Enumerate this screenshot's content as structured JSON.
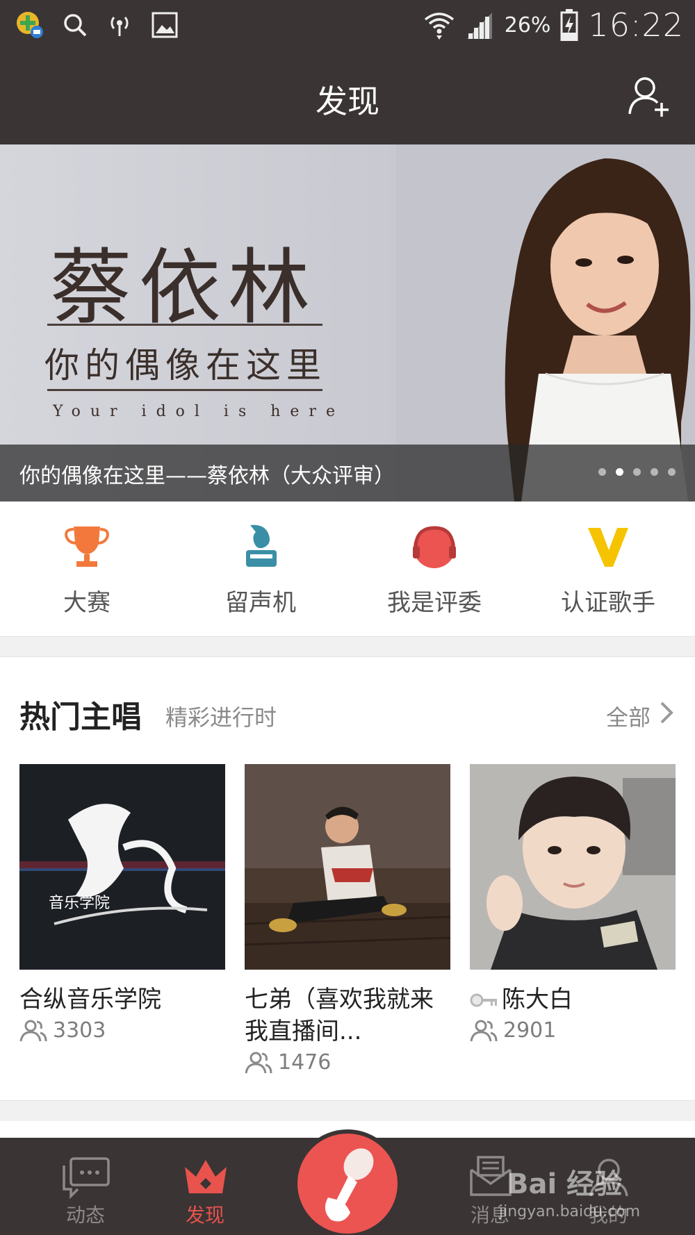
{
  "status_bar": {
    "battery_percent": "26%",
    "time": "16:22",
    "icons_left": [
      "app-notification-icon",
      "search-icon",
      "hotspot-icon",
      "image-icon"
    ],
    "icons_right": [
      "wifi-icon",
      "signal-icon",
      "battery-charging-icon"
    ]
  },
  "header": {
    "title": "发现",
    "action_icon": "add-friend-icon"
  },
  "banner": {
    "title": "蔡依林",
    "subtitle": "你的偶像在这里",
    "english": "Your idol is here",
    "caption": "你的偶像在这里——蔡依林（大众评审）",
    "page_count": 5,
    "active_index": 1
  },
  "quick_entries": [
    {
      "label": "大赛",
      "icon": "trophy-icon",
      "color": "#f2793b"
    },
    {
      "label": "留声机",
      "icon": "phonograph-icon",
      "color": "#3a8fa6"
    },
    {
      "label": "我是评委",
      "icon": "headphones-icon",
      "color": "#ec5451"
    },
    {
      "label": "认证歌手",
      "icon": "verified-v-icon",
      "color": "#f5c300"
    }
  ],
  "hot_singers": {
    "title": "热门主唱",
    "subtitle": "精彩进行时",
    "all_label": "全部",
    "cards": [
      {
        "name": "合纵音乐学院",
        "count": "3303",
        "thumb_text": "音乐学院",
        "has_key": false
      },
      {
        "name": "七弟（喜欢我就来我直播间...",
        "count": "1476",
        "has_key": false
      },
      {
        "name": "陈大白",
        "count": "2901",
        "has_key": true
      }
    ]
  },
  "tabbar": {
    "tabs": [
      {
        "label": "动态",
        "icon": "chat-bubble-icon",
        "active": false
      },
      {
        "label": "发现",
        "icon": "crown-icon",
        "active": true
      },
      {
        "label": "消息",
        "icon": "envelope-icon",
        "active": false
      },
      {
        "label": "我的",
        "icon": "profile-icon",
        "active": false
      }
    ],
    "center_icon": "microphone-icon"
  },
  "watermark": {
    "text": "Bai 经验",
    "url": "jingyan.baidu.com"
  },
  "colors": {
    "bar_bg": "#3a3434",
    "accent": "#ec5451"
  }
}
